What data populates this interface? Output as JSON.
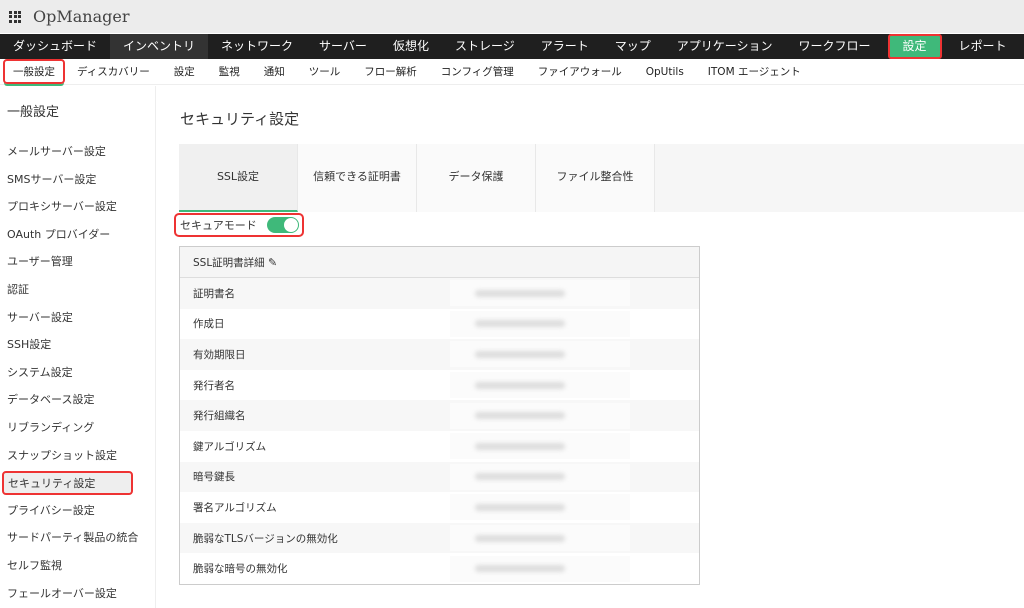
{
  "app": {
    "title": "OpManager"
  },
  "nav": [
    "ダッシュボード",
    "インベントリ",
    "ネットワーク",
    "サーバー",
    "仮想化",
    "ストレージ",
    "アラート",
    "マップ",
    "アプリケーション",
    "ワークフロー",
    "設定",
    "レポート"
  ],
  "subnav": [
    "一般設定",
    "ディスカバリー",
    "設定",
    "監視",
    "通知",
    "ツール",
    "フロー解析",
    "コンフィグ管理",
    "ファイアウォール",
    "OpUtils",
    "ITOM エージェント"
  ],
  "sidebar": {
    "heading": "一般設定",
    "items": [
      "メールサーバー設定",
      "SMSサーバー設定",
      "プロキシサーバー設定",
      "OAuth プロバイダー",
      "ユーザー管理",
      "認証",
      "サーバー設定",
      "SSH設定",
      "システム設定",
      "データベース設定",
      "リブランディング",
      "スナップショット設定",
      "セキュリティ設定",
      "プライバシー設定",
      "サードパーティ製品の統合",
      "セルフ監視",
      "フェールオーバー設定"
    ]
  },
  "main": {
    "title": "セキュリティ設定",
    "tabs": [
      "SSL設定",
      "信頼できる証明書",
      "データ保護",
      "ファイル整合性"
    ],
    "secure_mode": {
      "label": "セキュアモード",
      "on": true
    },
    "table": {
      "header": "SSL証明書詳細",
      "rows": [
        "証明書名",
        "作成日",
        "有効期限日",
        "発行者名",
        "発行組織名",
        "鍵アルゴリズム",
        "暗号鍵長",
        "署名アルゴリズム",
        "脆弱なTLSバージョンの無効化",
        "脆弱な暗号の無効化"
      ]
    }
  },
  "colors": {
    "accent": "#3fb97a",
    "highlight": "#e33333"
  }
}
